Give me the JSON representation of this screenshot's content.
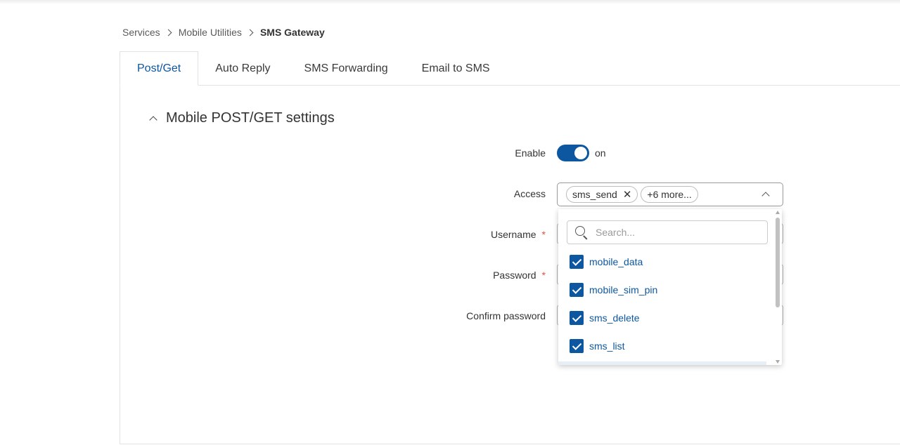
{
  "breadcrumb": {
    "items": [
      "Services",
      "Mobile Utilities"
    ],
    "current": "SMS Gateway"
  },
  "tabs": [
    {
      "label": "Post/Get",
      "active": true
    },
    {
      "label": "Auto Reply",
      "active": false
    },
    {
      "label": "SMS Forwarding",
      "active": false
    },
    {
      "label": "Email to SMS",
      "active": false
    }
  ],
  "section": {
    "title": "Mobile POST/GET settings"
  },
  "form": {
    "enable": {
      "label": "Enable",
      "state_text": "on",
      "checked": true
    },
    "access": {
      "label": "Access",
      "chip": "sms_send",
      "more_chip": "+6 more...",
      "search_placeholder": "Search...",
      "options": [
        {
          "label": "mobile_data",
          "checked": true
        },
        {
          "label": "mobile_sim_pin",
          "checked": true
        },
        {
          "label": "sms_delete",
          "checked": true
        },
        {
          "label": "sms_list",
          "checked": true
        }
      ]
    },
    "username": {
      "label": "Username",
      "required_mark": "*"
    },
    "password": {
      "label": "Password",
      "required_mark": "*"
    },
    "confirm_password": {
      "label": "Confirm password"
    }
  },
  "colors": {
    "accent": "#0d57a0",
    "required": "#e2523c"
  }
}
